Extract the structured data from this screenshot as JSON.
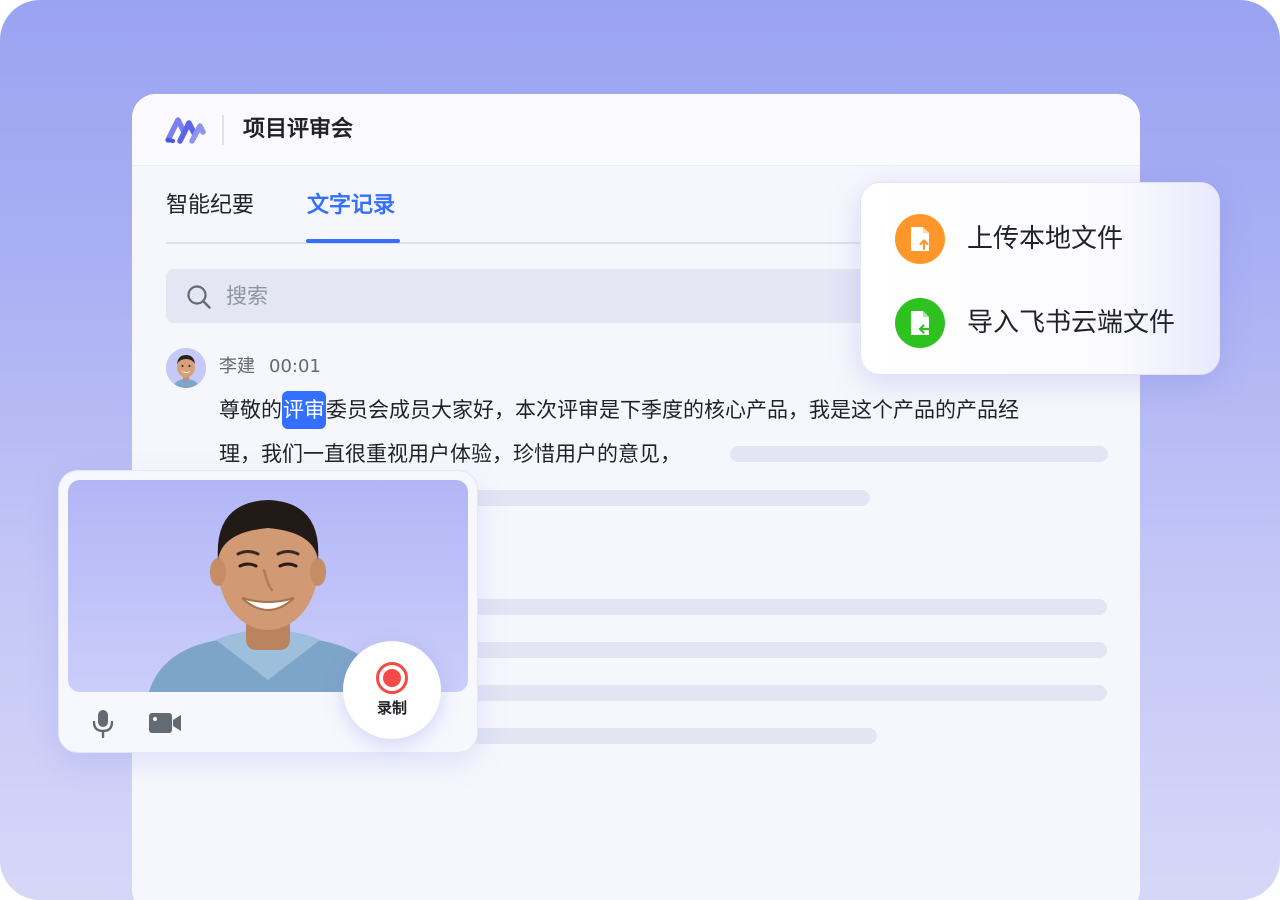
{
  "app": {
    "title": "项目评审会"
  },
  "tabs": [
    {
      "label": "智能纪要",
      "active": false
    },
    {
      "label": "文字记录",
      "active": true
    }
  ],
  "search": {
    "placeholder": "搜索"
  },
  "transcript": {
    "speaker": "李建",
    "time": "00:01",
    "line1_before": "尊敬的",
    "line1_highlight": "评审",
    "line1_after": "委员会成员大家好，本次评审是下季度的核心产品，我是这个产品的产品经",
    "line2": "理，我们一直很重视用户体验，珍惜用户的意见，"
  },
  "upload_menu": {
    "items": [
      {
        "label": "上传本地文件",
        "icon": "file-upload-icon",
        "color": "#ff9629"
      },
      {
        "label": "导入飞书云端文件",
        "icon": "file-import-icon",
        "color": "#2ec120"
      }
    ]
  },
  "video": {
    "record_label": "录制",
    "controls": [
      "microphone-icon",
      "camera-icon"
    ]
  },
  "colors": {
    "accent": "#3370ff",
    "background": "#a4abf3",
    "record": "#f54a45"
  }
}
